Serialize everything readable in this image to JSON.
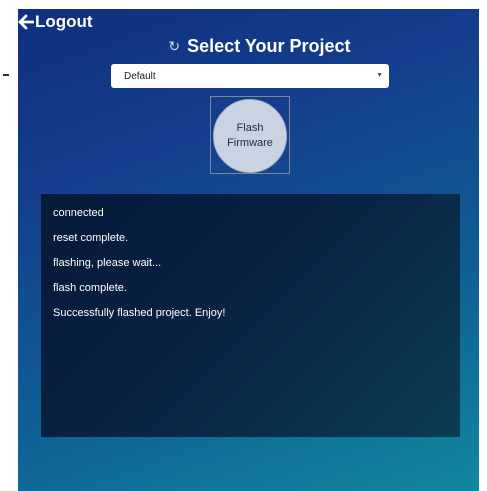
{
  "header": {
    "logout_label": "Logout",
    "title": "Select Your Project"
  },
  "icons": {
    "back": "arrow-left-icon",
    "refresh": "refresh-icon"
  },
  "project_select": {
    "selected_value": "Default"
  },
  "flash_button": {
    "line1": "Flash",
    "line2": "Firmware"
  },
  "console": {
    "lines": [
      "connected",
      "reset complete.",
      "flashing, please wait...",
      "flash complete.",
      "Successfully flashed project. Enjoy!"
    ]
  },
  "colors": {
    "background_top": "#0e2f7e",
    "background_bottom": "#13879f",
    "console_bg": "#061939",
    "flash_button_bg": "#c9d3e3"
  }
}
